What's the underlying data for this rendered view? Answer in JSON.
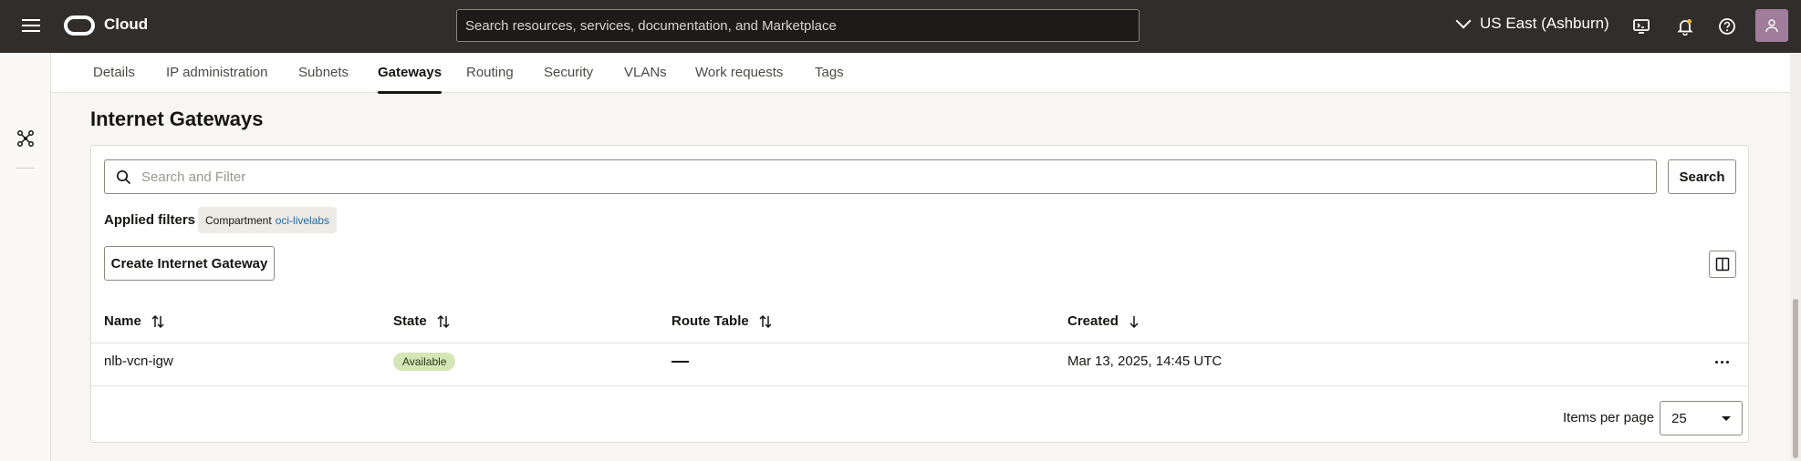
{
  "header": {
    "brand": "Cloud",
    "search_placeholder": "Search resources, services, documentation, and Marketplace",
    "region": "US East (Ashburn)"
  },
  "tabs": [
    {
      "label": "Details"
    },
    {
      "label": "IP administration"
    },
    {
      "label": "Subnets"
    },
    {
      "label": "Gateways"
    },
    {
      "label": "Routing"
    },
    {
      "label": "Security"
    },
    {
      "label": "VLANs"
    },
    {
      "label": "Work requests"
    },
    {
      "label": "Tags"
    }
  ],
  "section": {
    "title": "Internet Gateways",
    "filter_placeholder": "Search and Filter",
    "search_button": "Search",
    "applied_filters_label": "Applied filters",
    "chip_key": "Compartment",
    "chip_value": "oci-livelabs",
    "create_button": "Create Internet Gateway"
  },
  "table": {
    "columns": [
      "Name",
      "State",
      "Route Table",
      "Created"
    ],
    "rows": [
      {
        "name": "nlb-vcn-igw",
        "state": "Available",
        "route_table": "—",
        "created": "Mar 13, 2025, 14:45 UTC"
      }
    ]
  },
  "pagination": {
    "label": "Items per page",
    "value": "25"
  },
  "colors": {
    "topbar": "#312d2a",
    "badge_available": "#d4e6b5",
    "link": "#1f6c9f"
  }
}
